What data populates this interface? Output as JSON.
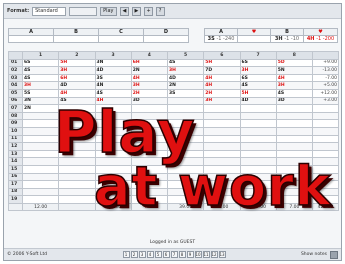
{
  "toolbar": {
    "format_label": "Format:",
    "format_value": "Standard",
    "secondary_value": "",
    "play_label": "Play",
    "small_buttons": [
      "◀",
      "▶",
      "+",
      "?"
    ]
  },
  "header_left": {
    "letters": [
      "A",
      "B",
      "C",
      "D"
    ]
  },
  "header_right": {
    "top": [
      {
        "label": "A",
        "value": "",
        "red": false
      },
      {
        "label": "♥",
        "value": "",
        "red": true
      },
      {
        "label": "B",
        "value": "",
        "red": false
      },
      {
        "label": "♥",
        "value": "",
        "red": true
      }
    ],
    "bottom": [
      {
        "label": "3S",
        "value": "-1 -240",
        "red": false
      },
      {
        "label": "",
        "value": "",
        "red": false
      },
      {
        "label": "3H",
        "value": "-1 -10",
        "red": false
      },
      {
        "label": "4H",
        "value": "-1 -200",
        "red": true
      }
    ]
  },
  "grid": {
    "columns": [
      "",
      "1",
      "2",
      "3",
      "4",
      "5",
      "6",
      "7",
      "8",
      ""
    ],
    "rows": [
      {
        "label": "01",
        "cells": [
          {
            "c": "6S",
            "r": false
          },
          {
            "c": "5H",
            "r": true
          },
          {
            "c": "3N",
            "r": false
          },
          {
            "c": "6H",
            "r": true
          },
          {
            "c": "4S",
            "r": false
          },
          {
            "c": "5H",
            "r": true
          },
          {
            "c": "6S",
            "r": false
          },
          {
            "c": "5D",
            "r": true
          }
        ],
        "total": "+9.00"
      },
      {
        "label": "02",
        "cells": [
          {
            "c": "4S",
            "r": false
          },
          {
            "c": "3H",
            "r": true
          },
          {
            "c": "4D",
            "r": false
          },
          {
            "c": "2N",
            "r": false
          },
          {
            "c": "3H",
            "r": true
          },
          {
            "c": "7D",
            "r": false
          },
          {
            "c": "3H",
            "r": true
          },
          {
            "c": "5N",
            "r": false
          }
        ],
        "total": "-13.00"
      },
      {
        "label": "03",
        "cells": [
          {
            "c": "4S",
            "r": false
          },
          {
            "c": "6H",
            "r": true
          },
          {
            "c": "3S",
            "r": false
          },
          {
            "c": "4H",
            "r": true
          },
          {
            "c": "4D",
            "r": false
          },
          {
            "c": "4H",
            "r": true
          },
          {
            "c": "6S",
            "r": false
          },
          {
            "c": "4H",
            "r": true
          }
        ],
        "total": "-7.00"
      },
      {
        "label": "04",
        "cells": [
          {
            "c": "3H",
            "r": true
          },
          {
            "c": "4D",
            "r": false
          },
          {
            "c": "4N",
            "r": false
          },
          {
            "c": "3H",
            "r": true
          },
          {
            "c": "2N",
            "r": false
          },
          {
            "c": "4H",
            "r": true
          },
          {
            "c": "4S",
            "r": false
          },
          {
            "c": "3H",
            "r": true
          }
        ],
        "total": "+5.00"
      },
      {
        "label": "05",
        "cells": [
          {
            "c": "5S",
            "r": false
          },
          {
            "c": "4H",
            "r": true
          },
          {
            "c": "4S",
            "r": false
          },
          {
            "c": "2H",
            "r": true
          },
          {
            "c": "3S",
            "r": false
          },
          {
            "c": "2H",
            "r": true
          },
          {
            "c": "5H",
            "r": true
          },
          {
            "c": "4S",
            "r": false
          }
        ],
        "total": "+12.00"
      },
      {
        "label": "06",
        "cells": [
          {
            "c": "3N",
            "r": false
          },
          {
            "c": "4S",
            "r": false
          },
          {
            "c": "4H",
            "r": true
          },
          {
            "c": "3D",
            "r": false
          },
          {
            "c": "",
            "r": false
          },
          {
            "c": "3H",
            "r": true
          },
          {
            "c": "4D",
            "r": false
          },
          {
            "c": "3D",
            "r": false
          }
        ],
        "total": "+3.00"
      },
      {
        "label": "07",
        "cells": [
          {
            "c": "2N",
            "r": false
          },
          {
            "c": "",
            "r": false
          },
          {
            "c": "",
            "r": false
          },
          {
            "c": "",
            "r": false
          },
          {
            "c": "",
            "r": false
          },
          {
            "c": "",
            "r": false
          },
          {
            "c": "",
            "r": false
          },
          {
            "c": "",
            "r": false
          }
        ],
        "total": ""
      },
      {
        "label": "08",
        "cells": [
          {
            "c": "",
            "r": false
          },
          {
            "c": "",
            "r": false
          },
          {
            "c": "",
            "r": false
          },
          {
            "c": "",
            "r": false
          },
          {
            "c": "",
            "r": false
          },
          {
            "c": "",
            "r": false
          },
          {
            "c": "",
            "r": false
          },
          {
            "c": "",
            "r": false
          }
        ],
        "total": ""
      },
      {
        "label": "09",
        "cells": [
          {
            "c": "",
            "r": false
          },
          {
            "c": "",
            "r": false
          },
          {
            "c": "",
            "r": false
          },
          {
            "c": "",
            "r": false
          },
          {
            "c": "",
            "r": false
          },
          {
            "c": "",
            "r": false
          },
          {
            "c": "",
            "r": false
          },
          {
            "c": "",
            "r": false
          }
        ],
        "total": ""
      },
      {
        "label": "10",
        "cells": [
          {
            "c": "",
            "r": false
          },
          {
            "c": "",
            "r": false
          },
          {
            "c": "",
            "r": false
          },
          {
            "c": "",
            "r": false
          },
          {
            "c": "",
            "r": false
          },
          {
            "c": "",
            "r": false
          },
          {
            "c": "",
            "r": false
          },
          {
            "c": "",
            "r": false
          }
        ],
        "total": ""
      },
      {
        "label": "11",
        "cells": [
          {
            "c": "",
            "r": false
          },
          {
            "c": "",
            "r": false
          },
          {
            "c": "",
            "r": false
          },
          {
            "c": "",
            "r": false
          },
          {
            "c": "",
            "r": false
          },
          {
            "c": "",
            "r": false
          },
          {
            "c": "",
            "r": false
          },
          {
            "c": "",
            "r": false
          }
        ],
        "total": ""
      },
      {
        "label": "12",
        "cells": [
          {
            "c": "",
            "r": false
          },
          {
            "c": "",
            "r": false
          },
          {
            "c": "",
            "r": false
          },
          {
            "c": "",
            "r": false
          },
          {
            "c": "",
            "r": false
          },
          {
            "c": "",
            "r": false
          },
          {
            "c": "",
            "r": false
          },
          {
            "c": "",
            "r": false
          }
        ],
        "total": ""
      },
      {
        "label": "13",
        "cells": [
          {
            "c": "",
            "r": false
          },
          {
            "c": "",
            "r": false
          },
          {
            "c": "",
            "r": false
          },
          {
            "c": "",
            "r": false
          },
          {
            "c": "",
            "r": false
          },
          {
            "c": "",
            "r": false
          },
          {
            "c": "",
            "r": false
          },
          {
            "c": "",
            "r": false
          }
        ],
        "total": ""
      },
      {
        "label": "14",
        "cells": [
          {
            "c": "",
            "r": false
          },
          {
            "c": "",
            "r": false
          },
          {
            "c": "",
            "r": false
          },
          {
            "c": "",
            "r": false
          },
          {
            "c": "",
            "r": false
          },
          {
            "c": "",
            "r": false
          },
          {
            "c": "",
            "r": false
          },
          {
            "c": "",
            "r": false
          }
        ],
        "total": ""
      },
      {
        "label": "15",
        "cells": [
          {
            "c": "",
            "r": false
          },
          {
            "c": "",
            "r": false
          },
          {
            "c": "",
            "r": false
          },
          {
            "c": "",
            "r": false
          },
          {
            "c": "",
            "r": false
          },
          {
            "c": "",
            "r": false
          },
          {
            "c": "",
            "r": false
          },
          {
            "c": "",
            "r": false
          }
        ],
        "total": ""
      },
      {
        "label": "16",
        "cells": [
          {
            "c": "",
            "r": false
          },
          {
            "c": "",
            "r": false
          },
          {
            "c": "",
            "r": false
          },
          {
            "c": "",
            "r": false
          },
          {
            "c": "",
            "r": false
          },
          {
            "c": "",
            "r": false
          },
          {
            "c": "",
            "r": false
          },
          {
            "c": "",
            "r": false
          }
        ],
        "total": ""
      },
      {
        "label": "17",
        "cells": [
          {
            "c": "",
            "r": false
          },
          {
            "c": "",
            "r": false
          },
          {
            "c": "",
            "r": false
          },
          {
            "c": "",
            "r": false
          },
          {
            "c": "",
            "r": false
          },
          {
            "c": "",
            "r": false
          },
          {
            "c": "",
            "r": false
          },
          {
            "c": "",
            "r": false
          }
        ],
        "total": ""
      },
      {
        "label": "18",
        "cells": [
          {
            "c": "",
            "r": false
          },
          {
            "c": "",
            "r": false
          },
          {
            "c": "",
            "r": false
          },
          {
            "c": "",
            "r": false
          },
          {
            "c": "",
            "r": false
          },
          {
            "c": "",
            "r": false
          },
          {
            "c": "",
            "r": false
          },
          {
            "c": "",
            "r": false
          }
        ],
        "total": ""
      },
      {
        "label": "19",
        "cells": [
          {
            "c": "",
            "r": false
          },
          {
            "c": "",
            "r": false
          },
          {
            "c": "",
            "r": false
          },
          {
            "c": "",
            "r": false
          },
          {
            "c": "",
            "r": false
          },
          {
            "c": "",
            "r": false
          },
          {
            "c": "",
            "r": false
          },
          {
            "c": "",
            "r": false
          }
        ],
        "total": ""
      }
    ],
    "totals": [
      {
        "v": "12.00",
        "r": false
      },
      {
        "v": "",
        "r": false
      },
      {
        "v": "106.00",
        "r": false
      },
      {
        "v": "7.00",
        "r": true
      },
      {
        "v": "39.00",
        "r": false
      },
      {
        "v": "66.00",
        "r": false
      },
      {
        "v": "177.00",
        "r": false
      },
      {
        "v": "7.00",
        "r": false
      },
      {
        "v": "428.00",
        "r": false
      }
    ]
  },
  "footer_note": "Logged in as GUEST",
  "status": {
    "left": "© 2006 Y-Soft Ltd",
    "pager": [
      "1",
      "2",
      "3",
      "4",
      "5",
      "6",
      "7",
      "8",
      "9",
      "10",
      "11",
      "12",
      "13"
    ],
    "right": "Show notes"
  },
  "overlay": {
    "line1": "Play",
    "line2": "at work",
    "color": "#e01010"
  }
}
